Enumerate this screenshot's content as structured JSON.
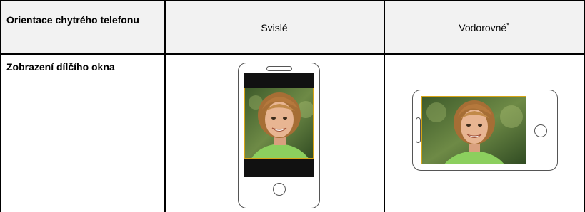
{
  "table": {
    "header": {
      "col1": "Orientace chytrého telefonu",
      "col2": "Svislé",
      "col3": "Vodorovné",
      "col3_note_mark": "*"
    },
    "row1": {
      "label": "Zobrazení dílčího okna"
    }
  },
  "images": {
    "portrait_phone": "smartphone-portrait-with-boy-photo",
    "landscape_phone": "smartphone-landscape-with-boy-photo"
  },
  "colors": {
    "header_bg": "#f2f2f2",
    "photo_border": "#d8a416",
    "screen_black": "#111111"
  }
}
